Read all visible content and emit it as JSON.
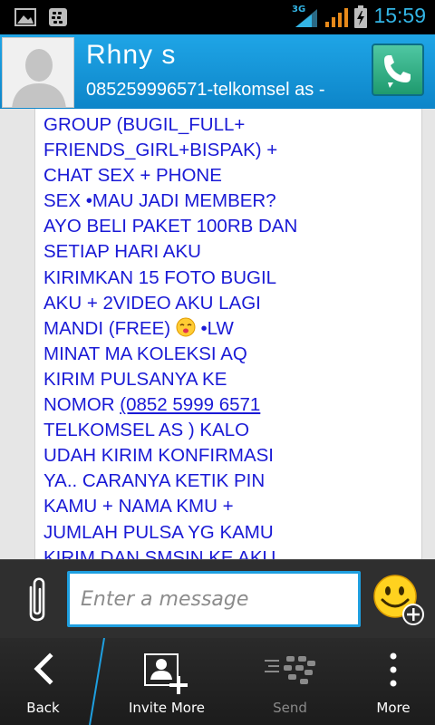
{
  "status_bar": {
    "time": "15:59",
    "network": "3G",
    "icons": [
      "gallery-icon",
      "bbm-notification-icon",
      "signal-3g-icon",
      "signal-bars-icon",
      "battery-charging-icon"
    ]
  },
  "header": {
    "contact_name": "Rhny s",
    "contact_subtitle": "085259996571-telkomsel as -"
  },
  "message": {
    "lines": [
      "GROUP (BUGIL_FULL+",
      "FRIENDS_GIRL+BISPAK) +",
      "CHAT SEX + PHONE",
      "SEX •MAU JADI MEMBER?",
      "AYO BELI PAKET 100RB DAN",
      "SETIAP HARI AKU",
      "KIRIMKAN 15 FOTO BUGIL",
      "AKU + 2VIDEO AKU LAGI",
      "MANDI (FREE)",
      " •LW",
      "MINAT MA KOLEKSI AQ",
      "KIRIM PULSANYA KE",
      "NOMOR ",
      "(0852 5999 6571",
      "TELKOMSEL AS ) KALO",
      "UDAH KIRIM KONFIRMASI",
      "YA.. CARANYA KETIK PIN",
      "KAMU + NAMA KMU +",
      "JUMLAH PULSA YG KAMU",
      "KIRIM DAN SMSIN KE AKU"
    ]
  },
  "compose": {
    "placeholder": "Enter a message"
  },
  "actions": {
    "back": "Back",
    "invite_more": "Invite More",
    "send": "Send",
    "more": "More"
  },
  "colors": {
    "accent": "#1e9fe0",
    "header": "#1596d8",
    "message_text": "#1a1ad6",
    "clock": "#33b5e5",
    "call_button": "#2fae80"
  }
}
